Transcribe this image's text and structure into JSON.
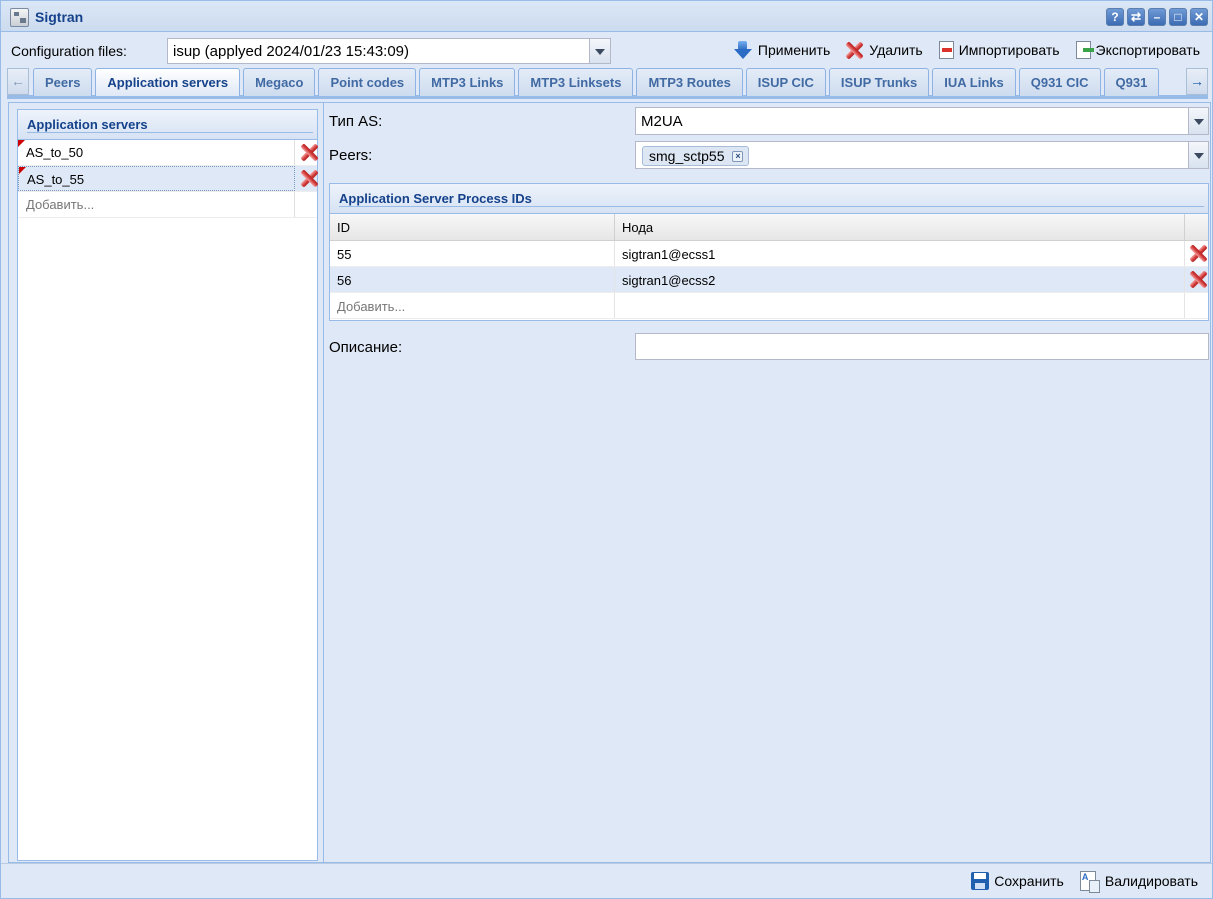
{
  "window": {
    "title": "Sigtran",
    "tool_buttons": [
      "?",
      "⇄",
      "–",
      "□",
      "✕"
    ]
  },
  "config": {
    "label": "Configuration files:",
    "selected": "isup (applyed 2024/01/23 15:43:09)"
  },
  "toolbar": {
    "apply": "Применить",
    "delete": "Удалить",
    "import": "Импортировать",
    "export": "Экспортировать"
  },
  "tabs": [
    "Peers",
    "Application servers",
    "Megaco",
    "Point codes",
    "MTP3 Links",
    "MTP3 Linksets",
    "MTP3 Routes",
    "ISUP CIC",
    "ISUP Trunks",
    "IUA Links",
    "Q931 CIC",
    "Q931"
  ],
  "active_tab": "Application servers",
  "left": {
    "header": "Application servers",
    "items": [
      "AS_to_50",
      "AS_to_55"
    ],
    "add_placeholder": "Добавить..."
  },
  "form": {
    "type_label": "Тип AS:",
    "type_value": "M2UA",
    "peers_label": "Peers:",
    "peers_chip": "smg_sctp55",
    "asp_header": "Application Server Process IDs",
    "columns": {
      "id": "ID",
      "node": "Нода"
    },
    "rows": [
      {
        "id": "55",
        "node": "sigtran1@ecss1"
      },
      {
        "id": "56",
        "node": "sigtran1@ecss2"
      }
    ],
    "add_placeholder": "Добавить...",
    "description_label": "Описание:",
    "description_value": ""
  },
  "footer": {
    "save": "Сохранить",
    "validate": "Валидировать"
  }
}
